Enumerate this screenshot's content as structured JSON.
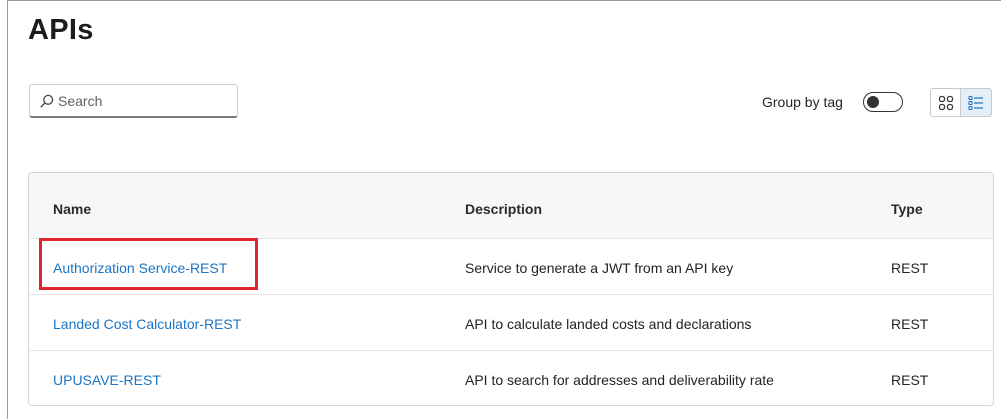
{
  "page": {
    "title": "APIs"
  },
  "toolbar": {
    "search_placeholder": "Search",
    "search_value": "",
    "group_by_tag_label": "Group by tag",
    "group_by_tag_enabled": false,
    "active_view": "list"
  },
  "table": {
    "columns": [
      "Name",
      "Description",
      "Type"
    ],
    "rows": [
      {
        "name": "Authorization Service-REST",
        "description": "Service to generate a JWT from an API key",
        "type": "REST",
        "highlighted": true
      },
      {
        "name": "Landed Cost Calculator-REST",
        "description": "API to calculate landed costs and declarations",
        "type": "REST",
        "highlighted": false
      },
      {
        "name": "UPUSAVE-REST",
        "description": "API to search for addresses and deliverability rate",
        "type": "REST",
        "highlighted": false
      }
    ]
  },
  "icons": {
    "search": "search-icon",
    "grid_view": "grid-view-icon",
    "list_view": "list-view-icon"
  },
  "colors": {
    "link": "#1b75c4",
    "highlight_border": "#e2262f",
    "active_view_bg": "#e4eef8",
    "header_bg": "#f7f7f7"
  }
}
